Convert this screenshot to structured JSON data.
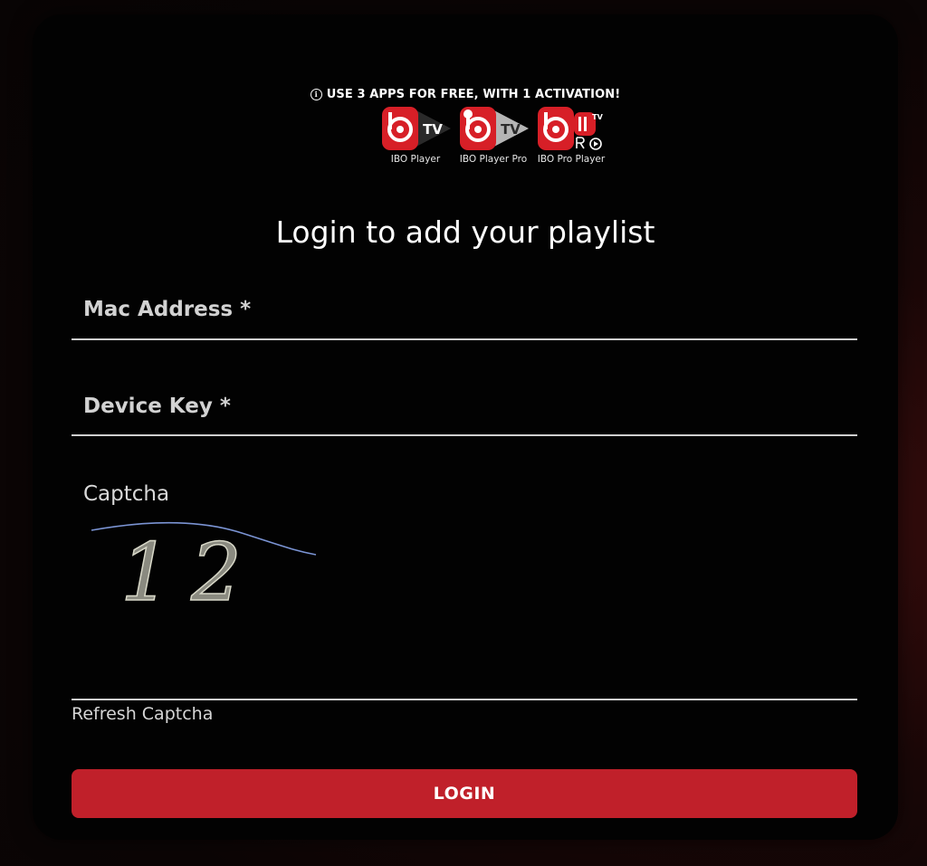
{
  "promo": {
    "icon": "info-icon",
    "text": "USE 3 APPS FOR FREE, WITH 1 ACTIVATION!"
  },
  "apps": [
    {
      "name": "IBO Player",
      "logo_text": "TV"
    },
    {
      "name": "IBO Player Pro",
      "logo_text": "TV"
    },
    {
      "name": "IBO Pro Player",
      "logo_text": "TV"
    }
  ],
  "brand_colors": {
    "red": "#c0202a",
    "logo_red": "#d71f27",
    "logo_grey": "#b5b5b5",
    "logo_dark": "#2a2a2a"
  },
  "form": {
    "title": "Login to add your playlist",
    "mac_placeholder": "Mac Address *",
    "mac_value": "",
    "device_key_placeholder": "Device Key *",
    "device_key_value": "",
    "captcha_label": "Captcha",
    "captcha_text": "12",
    "refresh_label": "Refresh Captcha",
    "login_label": "LOGIN"
  }
}
